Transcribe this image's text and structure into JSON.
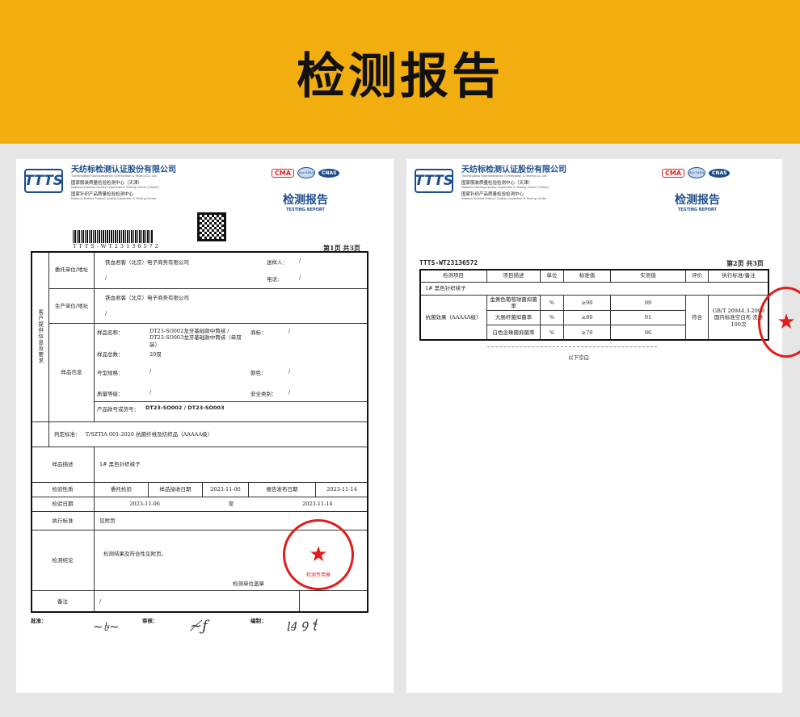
{
  "banner": {
    "title": "检测报告"
  },
  "org": {
    "logo": "TTTS",
    "name": "天纺标检测认证股份有限公司",
    "name_en": "TianFangBiao Standardization Certification & Testing Co.,Ltd.",
    "center1": "国家服装质量检验检测中心（天津）",
    "center1_en": "National Clothing Quality Inspection & Testing Center (Tianjin)",
    "center2": "国家针织产品质量检验检测中心",
    "center2_en": "National Knitted Product Quality Inspection & Testing Center"
  },
  "certs": {
    "cma": "CMA",
    "ilac": "ilac-MRA",
    "cnas": "CNAS"
  },
  "report": {
    "title": "检测报告",
    "title_en": "TESTING REPORT",
    "barcode_text": "TTTS-WT23136572"
  },
  "page1": {
    "page_no": "第1页  共3页",
    "side_label": "客户提供信息及要求",
    "client_label": "委托单位/地址",
    "client": "铁血君客（北京）电子商务有限公司",
    "client_addr": "/",
    "sender_label": "送样人：",
    "sender": "/",
    "phone_label": "电话：",
    "phone": "/",
    "maker_label": "生产单位/地址",
    "maker": "铁血君客（北京）电子商务有限公司",
    "maker_addr": "/",
    "sample_info_label": "样品信息",
    "sample_name_label": "样品名称：",
    "sample_name": "DT23-SO002龙牙基础款中筒袜 / DT23-SO003龙牙基础款中筒袜（单双装）",
    "trademark_label": "商标：",
    "trademark": "/",
    "sample_count_label": "样品总数：",
    "sample_count": "20双",
    "model_label": "号型规格：",
    "model": "/",
    "color_label": "颜色：",
    "color": "/",
    "grade_label": "质量等级：",
    "grade": "/",
    "safety_label": "安全类别：",
    "safety": "/",
    "style_label": "产品款号或货号：",
    "style": "DT23-SO002 / DT23-SO003",
    "judge_label": "判定标准：",
    "judge": "T/SZTIA 001-2020 抗菌纤维及纺织品（AAAAA级）",
    "desc_label": "样品描述",
    "desc": "1# 黑色针织袜子",
    "nature_label": "检验性质",
    "nature": "委托检验",
    "recv_label": "样品接收日期",
    "recv": "2023-11-06",
    "issue_label": "报告发布日期",
    "issue": "2023-11-14",
    "date_label": "检验日期",
    "date_from": "2023-11-06",
    "date_to_word": "至",
    "date_to": "2023-11-14",
    "std_label": "执行标准",
    "std": "见附页",
    "concl_label": "检测结论",
    "concl": "检测结果及符合性见附页。",
    "seal_note": "检测单位盖章",
    "remark_label": "备注",
    "remark": "/",
    "approve_label": "批准：",
    "review_label": "审核：",
    "compile_label": "编制：",
    "stamp_text": "天纺标检测认证股份有限公司",
    "stamp_sub": "检测专用章"
  },
  "page2": {
    "report_no": "TTTS-WT23136572",
    "page_no": "第2页  共3页",
    "headers": [
      "检测项目",
      "项目描述",
      "单位",
      "标准值",
      "实测值",
      "评价",
      "执行标准/备注"
    ],
    "sample": "1#   黑色针织袜子",
    "item": "抗菌效果（AAAAA级）",
    "rows": [
      {
        "desc": "金黄色葡萄球菌抑菌率",
        "unit": "%",
        "std": "≥90",
        "value": "99"
      },
      {
        "desc": "大肠杆菌抑菌率",
        "unit": "%",
        "std": "≥80",
        "value": "91"
      },
      {
        "desc": "白色念珠菌抑菌率",
        "unit": "%",
        "std": "≥70",
        "value": "96"
      }
    ],
    "eval": "符合",
    "note": "GB/T 20944.3-2008 国内标准空白布 洗涤100次",
    "end": "以下空白"
  }
}
